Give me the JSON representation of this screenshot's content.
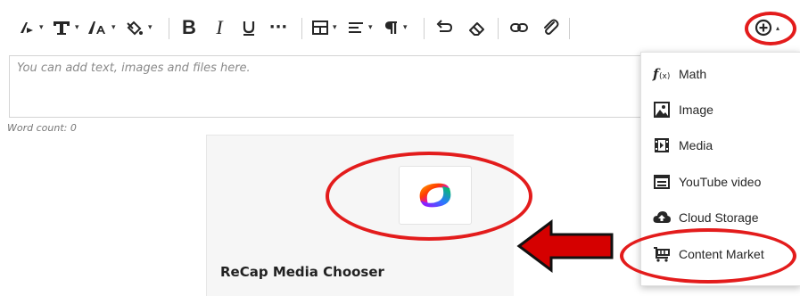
{
  "toolbar": {
    "caret": "▾",
    "bold_label": "B",
    "italic_label": "I",
    "more_label": "···"
  },
  "editor": {
    "placeholder": "You can add text, images and files here.",
    "word_count": "Word count: 0"
  },
  "card": {
    "title": "ReCap Media Chooser"
  },
  "insert_menu": {
    "items": [
      {
        "label": "Math",
        "icon": "function-icon"
      },
      {
        "label": "Image",
        "icon": "image-icon"
      },
      {
        "label": "Media",
        "icon": "film-icon"
      },
      {
        "label": "YouTube video",
        "icon": "video-window-icon"
      },
      {
        "label": "Cloud Storage",
        "icon": "cloud-upload-icon"
      },
      {
        "label": "Content Market",
        "icon": "shopping-cart-icon"
      }
    ]
  },
  "colors": {
    "annotation": "#e31c1c",
    "arrow_fill": "#d50000"
  }
}
